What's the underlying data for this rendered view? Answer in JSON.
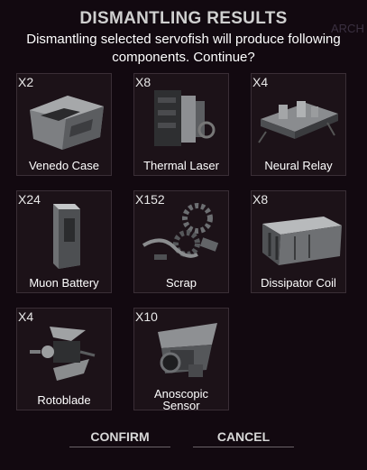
{
  "dialog": {
    "title": "DISMANTLING RESULTS",
    "message": "Dismantling selected servofish will produce following components. Continue?",
    "background_text": "ARCH"
  },
  "components": [
    {
      "qty": "X2",
      "name": "Venedo Case",
      "icon": "venedo-case-icon"
    },
    {
      "qty": "X8",
      "name": "Thermal Laser",
      "icon": "thermal-laser-icon"
    },
    {
      "qty": "X4",
      "name": "Neural Relay",
      "icon": "neural-relay-icon"
    },
    {
      "qty": "X24",
      "name": "Muon Battery",
      "icon": "muon-battery-icon"
    },
    {
      "qty": "X152",
      "name": "Scrap",
      "icon": "scrap-icon"
    },
    {
      "qty": "X8",
      "name": "Dissipator Coil",
      "icon": "dissipator-coil-icon"
    },
    {
      "qty": "X4",
      "name": "Rotoblade",
      "icon": "rotoblade-icon"
    },
    {
      "qty": "X10",
      "name": "Anoscopic Sensor",
      "icon": "anoscopic-sensor-icon"
    }
  ],
  "buttons": {
    "confirm": "CONFIRM",
    "cancel": "CANCEL"
  },
  "colors": {
    "background": "#120910",
    "tile_border": "#3a2e36",
    "tile_fill": "#1c1218"
  }
}
